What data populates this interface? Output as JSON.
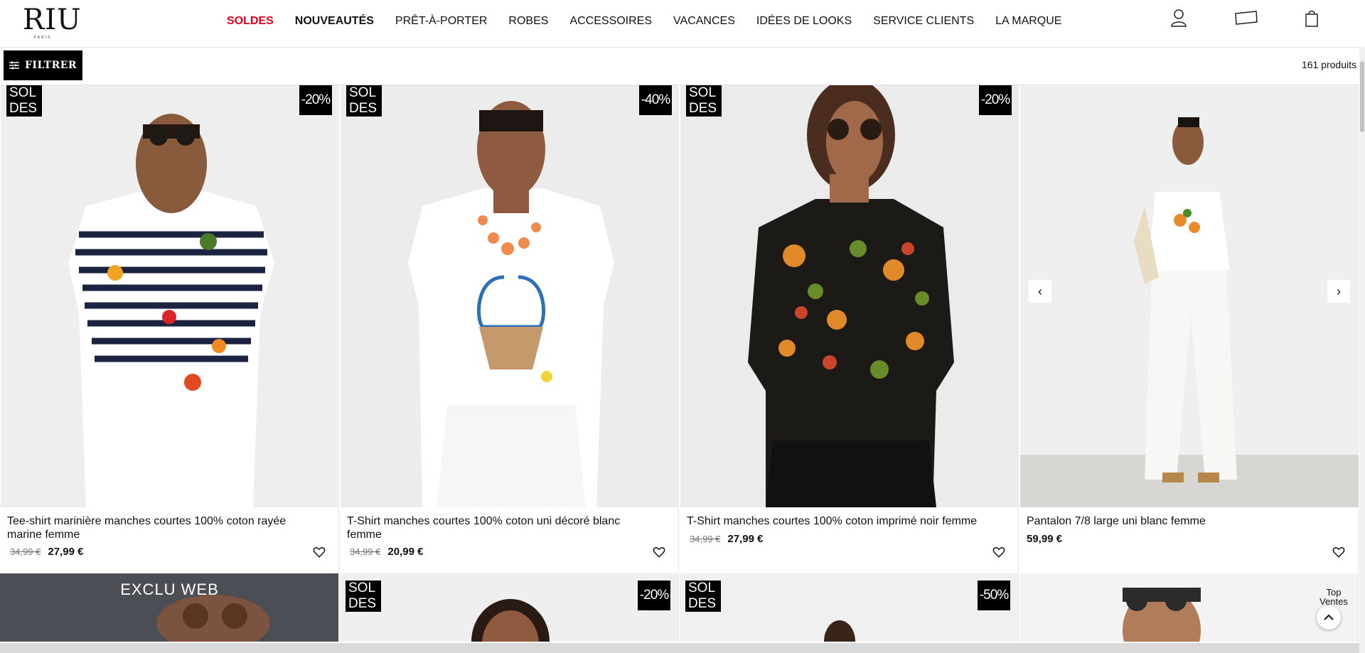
{
  "brand": {
    "logo": "RIU",
    "logo_sub": "PARIS"
  },
  "nav": {
    "items": [
      "SOLDES",
      "NOUVEAUTÉS",
      "PRÊT-À-PORTER",
      "ROBES",
      "ACCESSOIRES",
      "VACANCES",
      "IDÉES DE LOOKS",
      "SERVICE CLIENTS",
      "LA MARQUE"
    ]
  },
  "header_icons": [
    "user-icon",
    "gift-card-icon",
    "shopping-bag-icon"
  ],
  "filter": {
    "label": "FILTRER",
    "count": "161 produits"
  },
  "products": [
    {
      "badge": "SOL DES",
      "badge_line1": "SOL",
      "badge_line2": "DES",
      "discount": "-20%",
      "title": "Tee-shirt marinière manches courtes 100% coton rayée marine femme",
      "old_price": "34,99 €",
      "price": "27,99 €"
    },
    {
      "badge": "SOL DES",
      "badge_line1": "SOL",
      "badge_line2": "DES",
      "discount": "-40%",
      "title": "T-Shirt manches courtes 100% coton uni décoré blanc femme",
      "old_price": "34,99 €",
      "price": "20,99 €"
    },
    {
      "badge": "SOL DES",
      "badge_line1": "SOL",
      "badge_line2": "DES",
      "discount": "-20%",
      "title": "T-Shirt manches courtes 100% coton imprimé noir femme",
      "old_price": "34,99 €",
      "price": "27,99 €"
    },
    {
      "title": "Pantalon 7/8 large uni blanc femme",
      "price": "59,99 €"
    }
  ],
  "row2": [
    {
      "banner": "EXCLU WEB"
    },
    {
      "badge_line1": "SOL",
      "badge_line2": "DES",
      "discount": "-20%"
    },
    {
      "badge_line1": "SOL",
      "badge_line2": "DES",
      "discount": "-50%"
    },
    {}
  ],
  "top_ventes": "Top Ventes",
  "colors": {
    "sale": "#e3001b",
    "badge_bg": "#000000",
    "text": "#111111"
  }
}
